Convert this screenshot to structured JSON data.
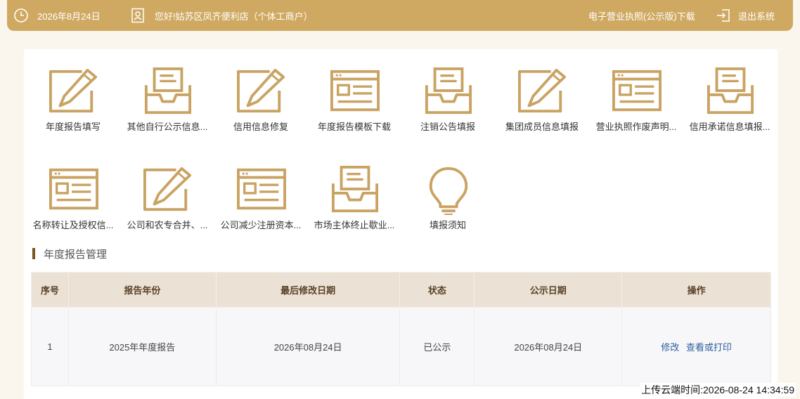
{
  "header": {
    "date": "2026年8月24日",
    "greeting": "您好!姑苏区凤齐便利店（个体工商户）",
    "license_download": "电子营业执照(公示版)下载",
    "logout": "退出系统"
  },
  "accent_color": "#cfa961",
  "tiles_row1": [
    {
      "label": "年度报告填写",
      "icon": "pencil-doc-icon"
    },
    {
      "label": "其他自行公示信息...",
      "icon": "inbox-tray-icon"
    },
    {
      "label": "信用信息修复",
      "icon": "pencil-doc-icon"
    },
    {
      "label": "年度报告模板下载",
      "icon": "browser-form-icon"
    },
    {
      "label": "注销公告填报",
      "icon": "inbox-tray-icon"
    },
    {
      "label": "集团成员信息填报",
      "icon": "pencil-doc-icon"
    },
    {
      "label": "营业执照作废声明...",
      "icon": "browser-form-icon"
    },
    {
      "label": "信用承诺信息填报...",
      "icon": "inbox-tray-icon"
    }
  ],
  "tiles_row2": [
    {
      "label": "名称转让及授权信...",
      "icon": "browser-form-icon"
    },
    {
      "label": "公司和农专合并、...",
      "icon": "pencil-doc-icon"
    },
    {
      "label": "公司减少注册资本...",
      "icon": "browser-form-icon"
    },
    {
      "label": "市场主体终止歇业...",
      "icon": "inbox-tray-icon"
    },
    {
      "label": "填报须知",
      "icon": "lightbulb-icon"
    }
  ],
  "section_title": "年度报告管理",
  "table": {
    "headers": [
      "序号",
      "报告年份",
      "最后修改日期",
      "状态",
      "公示日期",
      "操作"
    ],
    "rows": [
      {
        "index": "1",
        "year": "2025年年度报告",
        "modified": "2026年08月24日",
        "status": "已公示",
        "published": "2026年08月24日",
        "action_edit": "修改",
        "action_view": "查看或打印"
      }
    ]
  },
  "upload_time": "上传云端时间:2026-08-24 14:34:59"
}
